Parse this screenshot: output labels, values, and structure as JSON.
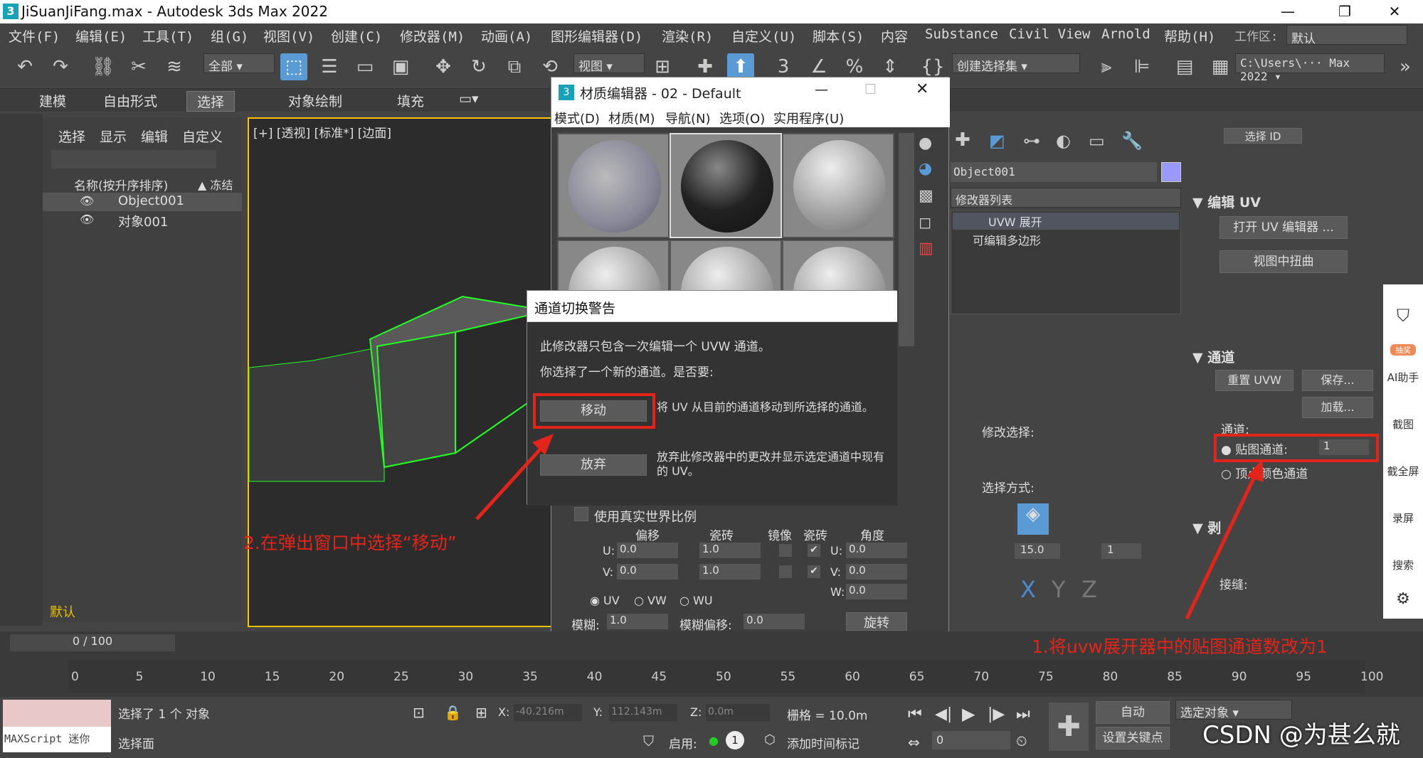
{
  "window": {
    "title": "JiSuanJiFang.max - Autodesk 3ds Max 2022",
    "logo": "3"
  },
  "menu": [
    "文件(F)",
    "编辑(E)",
    "工具(T)",
    "组(G)",
    "视图(V)",
    "创建(C)",
    "修改器(M)",
    "动画(A)",
    "图形编辑器(D)",
    "渲染(R)",
    "自定义(U)",
    "脚本(S)",
    "内容",
    "Substance",
    "Civil View",
    "Arnold",
    "帮助(H)"
  ],
  "workspace": {
    "label": "工作区:",
    "value": "默认"
  },
  "toolbar": {
    "filter": "全部",
    "view": "视图",
    "selset": "创建选择集",
    "path": "C:\\Users\\··· Max 2022"
  },
  "ribbon": [
    "建模",
    "自由形式",
    "选择",
    "对象绘制",
    "填充"
  ],
  "scene": {
    "tabs": [
      "选择",
      "显示",
      "编辑",
      "自定义"
    ],
    "col_name": "名称(按升序排序)",
    "col_freeze": "▲ 冻结",
    "rows": [
      "Object001",
      "对象001"
    ]
  },
  "viewport": {
    "label": "[+] [透视] [标准*] [边面]"
  },
  "mat": {
    "title": "材质编辑器 - 02 - Default",
    "logo": "3",
    "menu": [
      "模式(D)",
      "材质(M)",
      "导航(N)",
      "选项(O)",
      "实用程序(U)"
    ],
    "realworld": "使用真实世界比例",
    "cols": [
      "偏移",
      "瓷砖",
      "镜像",
      "瓷砖",
      "角度"
    ],
    "u": "U:",
    "v": "V:",
    "w": "W:",
    "u_off": "0.0",
    "v_off": "0.0",
    "u_tile": "1.0",
    "v_tile": "1.0",
    "u_ang": "0.0",
    "v_ang": "0.0",
    "w_ang": "0.0",
    "radio": [
      "UV",
      "VW",
      "WU"
    ],
    "blur": "模糊:",
    "blur_v": "1.0",
    "bluroff": "模糊偏移:",
    "bluroff_v": "0.0",
    "rotate": "旋转"
  },
  "dialog": {
    "title": "通道切换警告",
    "line1": "此修改器只包含一次编辑一个 UVW 通道。",
    "line2": "你选择了一个新的通道。是否要:",
    "move": "移动",
    "move_desc": "将 UV 从目前的通道移动到所选择的通道。",
    "discard": "放弃",
    "discard_desc": "放弃此修改器中的更改并显示选定通道中现有的 UV。"
  },
  "cmd": {
    "obj": "Object001",
    "modlist": "修改器列表",
    "stack": [
      "UVW 展开",
      "可编辑多边形"
    ],
    "modsel": "修改选择:",
    "selmode": "选择方式:",
    "angle": "15.0",
    "count": "1"
  },
  "rpanel": {
    "top": "选择 ID",
    "unwrap": "编辑 UV",
    "open": "打开 UV 编辑器 ...",
    "distort": "视图中扭曲",
    "channel_hdr": "通道",
    "reset": "重置 UVW",
    "save": "保存...",
    "load": "加载...",
    "ch_label": "通道:",
    "map_ch": "贴图通道:",
    "map_val": "1",
    "vtx": "顶点颜色通道",
    "peel": "剥",
    "seam": "接缝:"
  },
  "side": [
    "AI助手",
    "截图",
    "截全屏",
    "录屏",
    "搜索"
  ],
  "side_badge": "抽奖",
  "timeline": {
    "frame": "0 / 100",
    "ticks": [
      "0",
      "5",
      "10",
      "15",
      "20",
      "25",
      "30",
      "35",
      "40",
      "45",
      "50",
      "55",
      "60",
      "65",
      "70",
      "75",
      "80",
      "85",
      "90",
      "95",
      "100"
    ]
  },
  "status": {
    "selected": "选择了 1 个 对象",
    "face": "选择面",
    "x": "X:",
    "xv": "-40.216m",
    "y": "Y:",
    "yv": "112.143m",
    "z": "Z:",
    "zv": "0.0m",
    "grid": "栅格 = 10.0m",
    "enable": "启用:",
    "addtime": "添加时间标记",
    "auto": "自动",
    "setkey": "设置关键点",
    "selobj": "选定对象",
    "keyv": "0",
    "keyfilter": "1",
    "maxscript": "MAXScript 迷你"
  },
  "scene_default": "默认",
  "notes": {
    "n1": "1.将uvw展开器中的贴图通道数改为1",
    "n2": "2.在弹出窗口中选择“移动”"
  },
  "watermark": "CSDN @为甚么就",
  "colors": {
    "accent": "#e3241b",
    "highlight": "#ffc000"
  }
}
